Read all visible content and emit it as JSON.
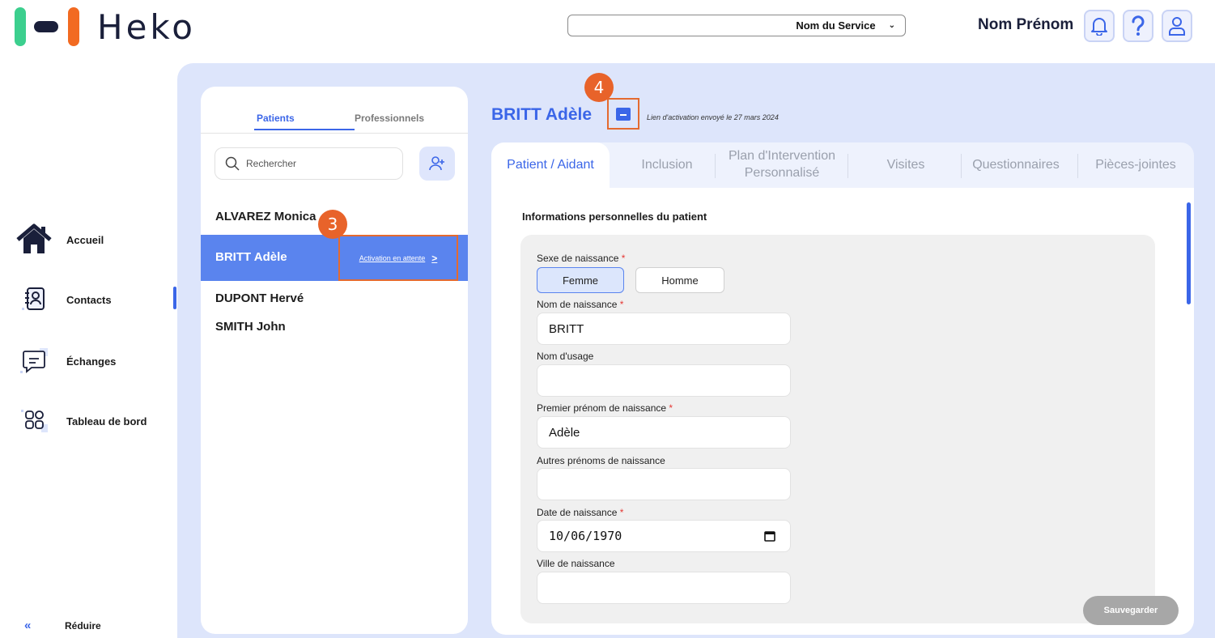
{
  "app": {
    "logo_text": "Heko"
  },
  "header": {
    "service_select_value": "Nom du Service",
    "user_name": "Nom Prénom"
  },
  "nav": {
    "items": [
      {
        "label": "Accueil",
        "icon": "home-icon"
      },
      {
        "label": "Contacts",
        "icon": "contacts-icon",
        "active": true
      },
      {
        "label": "Échanges",
        "icon": "chat-icon"
      },
      {
        "label": "Tableau de bord",
        "icon": "dashboard-icon"
      }
    ],
    "reduce_label": "Réduire",
    "reduce_icon": "«"
  },
  "contacts": {
    "tabs": [
      "Patients",
      "Professionnels"
    ],
    "search_placeholder": "Rechercher",
    "list": [
      "ALVAREZ Monica",
      "BRITT Adèle",
      "DUPONT Hervé",
      "SMITH John"
    ],
    "selected_activation_label": "Activation en attente",
    "selected_arrow": ">"
  },
  "steps": {
    "step3": "3",
    "step4": "4"
  },
  "patient": {
    "title": "BRITT Adèle",
    "activation_note": "Lien d'activation envoyé le 27 mars 2024",
    "tabs": [
      "Patient / Aidant",
      "Inclusion",
      "Plan d'Intervention Personnalisé",
      "Visites",
      "Questionnaires",
      "Pièces-jointes"
    ],
    "section_title": "Informations personnelles du patient",
    "form": {
      "sex_label": "Sexe de naissance",
      "sex_options": [
        "Femme",
        "Homme"
      ],
      "birth_name_label": "Nom de naissance",
      "birth_name_value": "BRITT",
      "usage_name_label": "Nom d'usage",
      "usage_name_value": "",
      "first_name_label": "Premier prénom de naissance",
      "first_name_value": "Adèle",
      "other_names_label": "Autres prénoms de naissance",
      "other_names_value": "",
      "birth_date_label": "Date de naissance",
      "birth_date_value": "10/06/1970",
      "birth_city_label": "Ville de naissance",
      "required_mark": "*"
    },
    "save_label": "Sauvegarder"
  },
  "colors": {
    "accent": "#3b66e8",
    "selected_row": "#5a84ee",
    "panel_bg": "#dde5fb",
    "highlight": "#e46a2f"
  }
}
